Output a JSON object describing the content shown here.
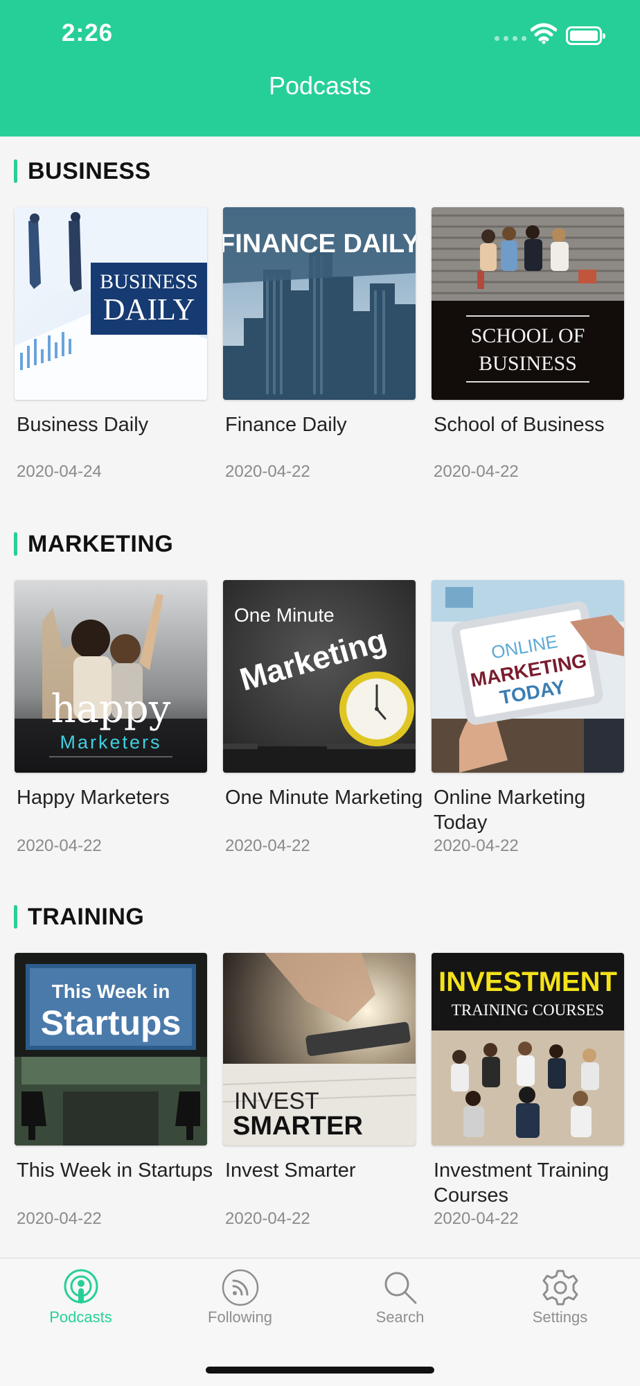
{
  "status_bar": {
    "time": "2:26"
  },
  "header": {
    "title": "Podcasts"
  },
  "sections": [
    {
      "title": "BUSINESS",
      "items": [
        {
          "title": "Business Daily",
          "date": "2020-04-24",
          "art_lines": [
            "BUSINESS",
            "DAILY"
          ]
        },
        {
          "title": "Finance Daily",
          "date": "2020-04-22",
          "art_lines": [
            "FINANCE DAILY"
          ]
        },
        {
          "title": "School of Business",
          "date": "2020-04-22",
          "art_lines": [
            "SCHOOL OF",
            "BUSINESS"
          ]
        }
      ]
    },
    {
      "title": "MARKETING",
      "items": [
        {
          "title": "Happy Marketers",
          "date": "2020-04-22",
          "art_lines": [
            "happy",
            "Marketers"
          ]
        },
        {
          "title": "One Minute Marketing",
          "date": "2020-04-22",
          "art_lines": [
            "One Minute",
            "Marketing"
          ]
        },
        {
          "title": "Online Marketing Today",
          "date": "2020-04-22",
          "art_lines": [
            "ONLINE",
            "MARKETING",
            "TODAY"
          ]
        }
      ]
    },
    {
      "title": "TRAINING",
      "items": [
        {
          "title": "This Week in Startups",
          "date": "2020-04-22",
          "art_lines": [
            "This Week in",
            "Startups"
          ]
        },
        {
          "title": "Invest Smarter",
          "date": "2020-04-22",
          "art_lines": [
            "INVEST",
            "SMARTER"
          ]
        },
        {
          "title": "Investment Training Courses",
          "date": "2020-04-22",
          "art_lines": [
            "INVESTMENT",
            "TRAINING COURSES"
          ]
        }
      ]
    }
  ],
  "tabs": [
    {
      "label": "Podcasts",
      "icon": "podcast-icon",
      "active": true
    },
    {
      "label": "Following",
      "icon": "rss-icon",
      "active": false
    },
    {
      "label": "Search",
      "icon": "search-icon",
      "active": false
    },
    {
      "label": "Settings",
      "icon": "gear-icon",
      "active": false
    }
  ],
  "colors": {
    "accent": "#27cf98",
    "inactive": "#8e8e8e"
  }
}
